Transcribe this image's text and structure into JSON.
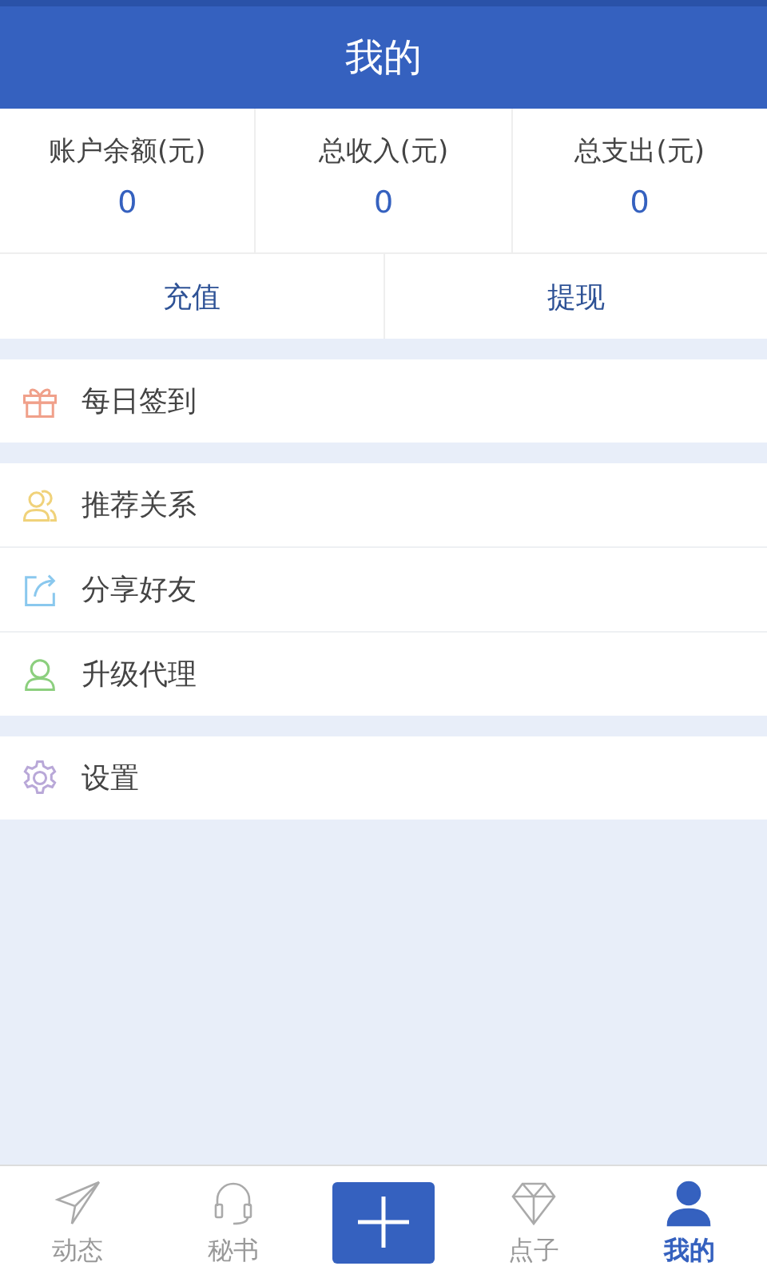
{
  "header": {
    "title": "我的"
  },
  "stats": [
    {
      "label": "账户余额(元)",
      "value": "0"
    },
    {
      "label": "总收入(元)",
      "value": "0"
    },
    {
      "label": "总支出(元)",
      "value": "0"
    }
  ],
  "actions": [
    "充值",
    "提现"
  ],
  "menu_groups": [
    [
      {
        "label": "每日签到",
        "kind": "gift",
        "color": "#f0a08a"
      }
    ],
    [
      {
        "label": "推荐关系",
        "kind": "users",
        "color": "#f0d27a"
      },
      {
        "label": "分享好友",
        "kind": "share",
        "color": "#8ac8ee"
      },
      {
        "label": "升级代理",
        "kind": "user",
        "color": "#8ccf7e"
      }
    ],
    [
      {
        "label": "设置",
        "kind": "gear",
        "color": "#b9a8d8"
      }
    ]
  ],
  "tabs": [
    {
      "label": "动态",
      "kind": "plane",
      "selected": false
    },
    {
      "label": "秘书",
      "kind": "headset",
      "selected": false
    },
    {
      "kind": "add",
      "selected": false
    },
    {
      "label": "点子",
      "kind": "diamond",
      "selected": false
    },
    {
      "label": "我的",
      "kind": "person",
      "selected": true
    }
  ]
}
